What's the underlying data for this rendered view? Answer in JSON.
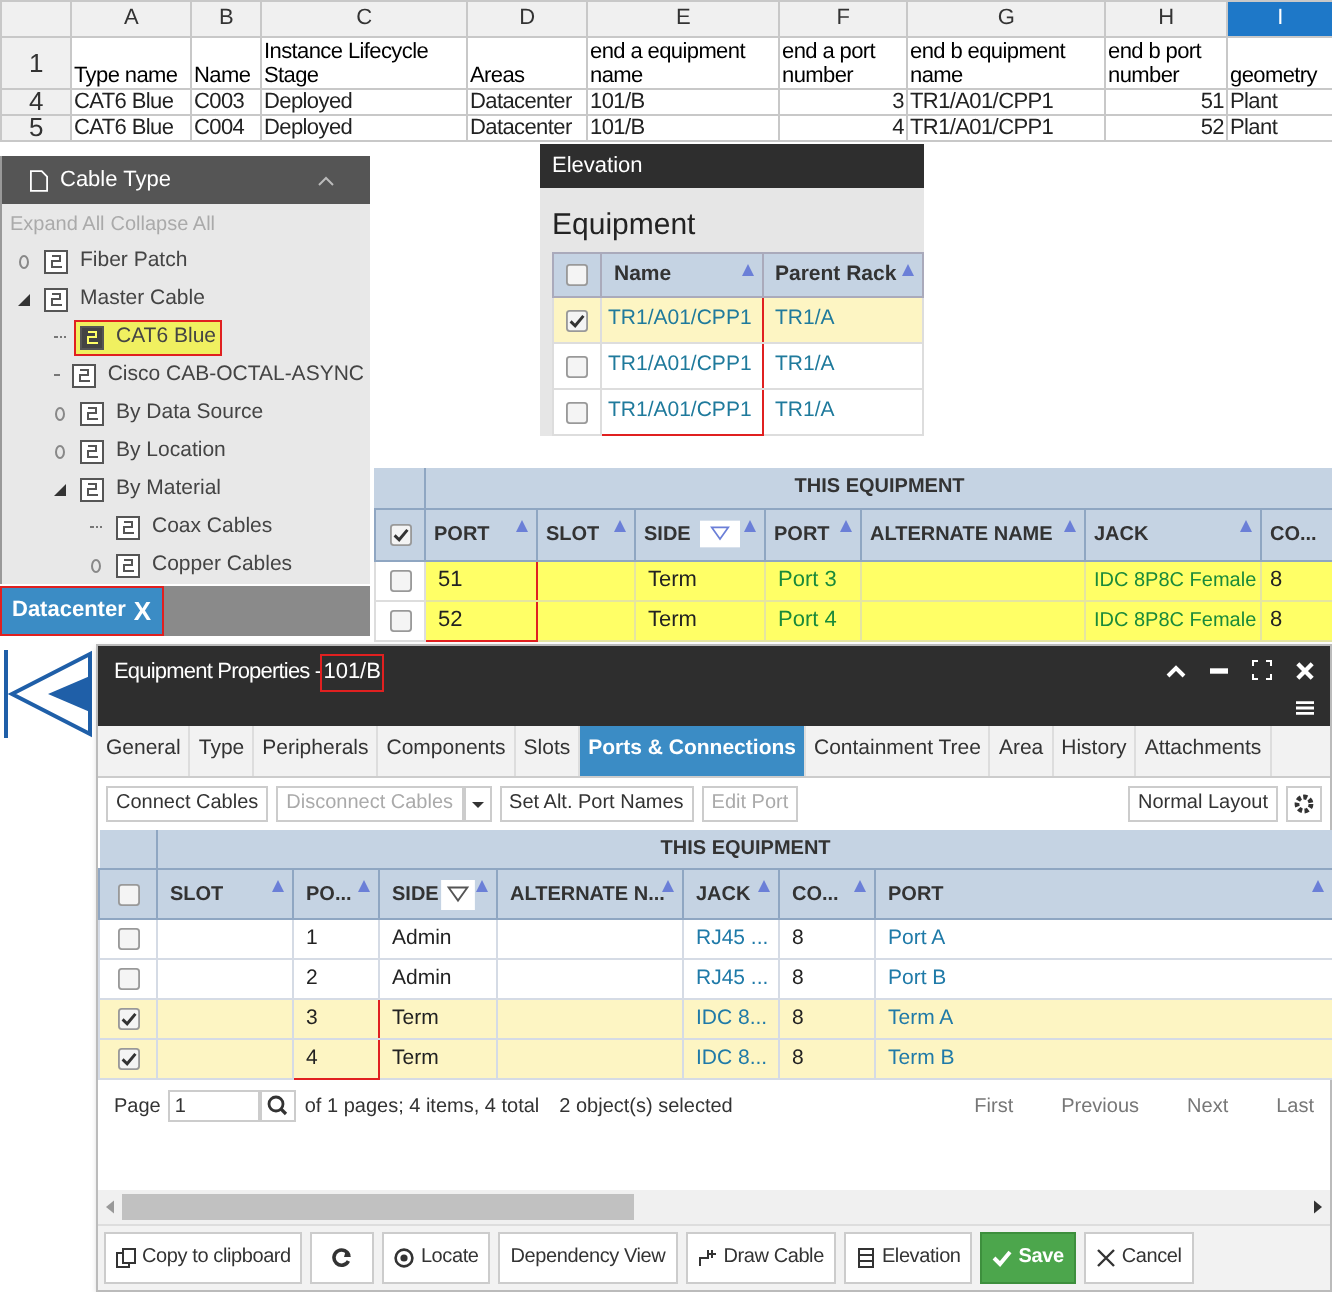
{
  "spreadsheet": {
    "corner_row": "1",
    "columns": [
      {
        "letter": "A",
        "header": "Type name",
        "selected": false
      },
      {
        "letter": "B",
        "header": "Name",
        "selected": false
      },
      {
        "letter": "C",
        "header": "Instance Lifecycle Stage",
        "selected": false
      },
      {
        "letter": "D",
        "header": "Areas",
        "selected": false
      },
      {
        "letter": "E",
        "header": "end a equipment name",
        "selected": false
      },
      {
        "letter": "F",
        "header": "end a port number",
        "selected": false
      },
      {
        "letter": "G",
        "header": "end b equipment name",
        "selected": false
      },
      {
        "letter": "H",
        "header": "end b port number",
        "selected": false
      },
      {
        "letter": "I",
        "header": "geometry",
        "selected": true
      }
    ],
    "rows": [
      {
        "number": "4",
        "cells": [
          "CAT6 Blue",
          "C003",
          "Deployed",
          "Datacenter",
          "101/B",
          "3",
          "TR1/A01/CPP1",
          "51",
          "Plant"
        ]
      },
      {
        "number": "5",
        "cells": [
          "CAT6 Blue",
          "C004",
          "Deployed",
          "Datacenter",
          "101/B",
          "4",
          "TR1/A01/CPP1",
          "52",
          "Plant"
        ]
      }
    ]
  },
  "cable_type_panel": {
    "title": "Cable Type",
    "links": [
      "Expand All",
      "Collapse All"
    ],
    "tree": [
      {
        "label": "Fiber Patch",
        "expanded": false,
        "selected": false
      },
      {
        "label": "Master Cable",
        "expanded": true,
        "selected": false,
        "children": [
          {
            "label": "CAT6 Blue",
            "selected": true,
            "annotated": true
          },
          {
            "label": "Cisco CAB-OCTAL-ASYNC",
            "selected": false
          },
          {
            "label": "By Data Source",
            "expanded": false,
            "selected": false
          },
          {
            "label": "By Location",
            "expanded": false,
            "selected": false
          },
          {
            "label": "By Material",
            "expanded": true,
            "selected": false,
            "children": [
              {
                "label": "Coax Cables",
                "selected": false
              },
              {
                "label": "Copper Cables",
                "expanded": false,
                "selected": false
              }
            ]
          }
        ]
      }
    ]
  },
  "datacenter_tab": {
    "label": "Datacenter",
    "close": "X",
    "annotated": true
  },
  "elevation_panel": {
    "title": "Elevation",
    "heading": "Equipment",
    "header_checked": false,
    "columns": [
      "Name",
      "Parent Rack"
    ],
    "rows": [
      {
        "checked": true,
        "name": "TR1/A01/CPP1",
        "parent_rack": "TR1/A",
        "annotated": true
      },
      {
        "checked": false,
        "name": "TR1/A01/CPP1",
        "parent_rack": "TR1/A",
        "annotated": true
      },
      {
        "checked": false,
        "name": "TR1/A01/CPP1",
        "parent_rack": "TR1/A",
        "annotated": true
      }
    ]
  },
  "connections_table": {
    "group": "THIS EQUIPMENT",
    "header_checked": true,
    "columns": [
      "PORT",
      "SLOT",
      "SIDE",
      "PORT",
      "ALTERNATE NAME",
      "JACK",
      "CO..."
    ],
    "rows": [
      {
        "checked": false,
        "port": "51",
        "side": "Term",
        "other_port": "Port 3",
        "jack": "IDC 8P8C Female",
        "co": "8",
        "annotated": true
      },
      {
        "checked": false,
        "port": "52",
        "side": "Term",
        "other_port": "Port 4",
        "jack": "IDC 8P8C Female",
        "co": "8",
        "annotated": true
      }
    ]
  },
  "equipment_properties": {
    "title": "Equipment Properties - ",
    "subject": "101/B",
    "subject_annotated": true,
    "tabs": [
      {
        "label": "General",
        "selected": false
      },
      {
        "label": "Type",
        "selected": false
      },
      {
        "label": "Peripherals",
        "selected": false
      },
      {
        "label": "Components",
        "selected": false
      },
      {
        "label": "Slots",
        "selected": false
      },
      {
        "label": "Ports & Connections",
        "selected": true
      },
      {
        "label": "Containment Tree",
        "selected": false
      },
      {
        "label": "Area",
        "selected": false
      },
      {
        "label": "History",
        "selected": false
      },
      {
        "label": "Attachments",
        "selected": false
      }
    ],
    "toolbar": [
      {
        "label": "Connect Cables",
        "disabled": false
      },
      {
        "label": "Disconnect Cables",
        "disabled": true
      },
      {
        "label": "Set Alt. Port Names",
        "disabled": false
      },
      {
        "label": "Edit Port",
        "disabled": true
      }
    ],
    "layout_button": "Normal Layout",
    "group": "THIS EQUIPMENT",
    "header_checked": false,
    "columns": [
      "SLOT",
      "PO...",
      "SIDE",
      "ALTERNATE N...",
      "JACK",
      "CO...",
      "PORT"
    ],
    "rows": [
      {
        "checked": false,
        "po": "1",
        "side": "Admin",
        "jack": "RJ45 ...",
        "co": "8",
        "port": "Port A",
        "annotated": false
      },
      {
        "checked": false,
        "po": "2",
        "side": "Admin",
        "jack": "RJ45 ...",
        "co": "8",
        "port": "Port B",
        "annotated": false
      },
      {
        "checked": true,
        "po": "3",
        "side": "Term",
        "jack": "IDC 8...",
        "co": "8",
        "port": "Term A",
        "annotated": true
      },
      {
        "checked": true,
        "po": "4",
        "side": "Term",
        "jack": "IDC 8...",
        "co": "8",
        "port": "Term B",
        "annotated": true
      }
    ],
    "pager": {
      "label": "Page",
      "page": "1",
      "info": "of 1 pages; 4 items, 4 total",
      "selection": "2 object(s) selected",
      "nav": [
        "First",
        "Previous",
        "Next",
        "Last"
      ]
    },
    "footer": [
      {
        "label": "Copy to clipboard",
        "kind": "copy"
      },
      {
        "kind": "refresh"
      },
      {
        "label": "Locate",
        "kind": "locate"
      },
      {
        "label": "Dependency View",
        "kind": "plain"
      },
      {
        "label": "Draw Cable",
        "kind": "draw"
      },
      {
        "label": "Elevation",
        "kind": "elevation"
      },
      {
        "label": "Save",
        "kind": "save"
      },
      {
        "label": "Cancel",
        "kind": "cancel"
      }
    ]
  }
}
